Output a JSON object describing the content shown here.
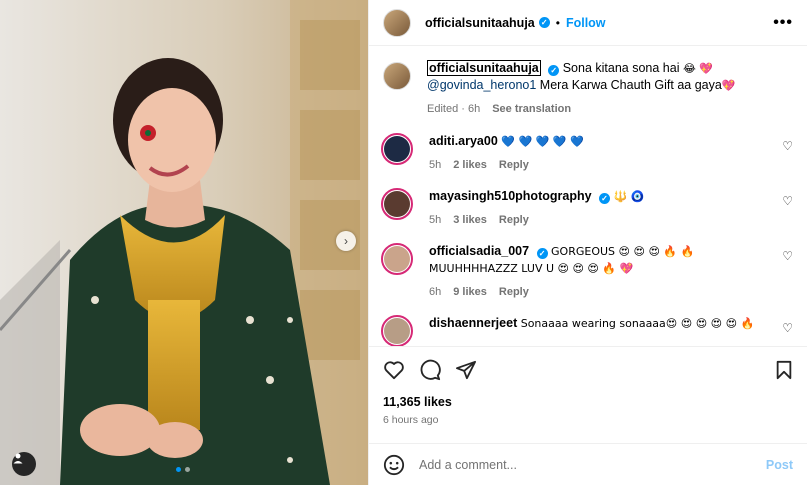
{
  "post": {
    "author": "officialsunitaahuja",
    "follow_label": "Follow",
    "separator": "•",
    "more_label": "•••",
    "caption_user": "officialsunitaahuja",
    "caption_text": "Sona kitana sona hai",
    "caption_emoji": "😂 💖",
    "caption_mention": "@govinda_herono1",
    "caption_text2": "Mera Karwa Chauth Gift aa gaya",
    "caption_emoji2": "💖",
    "caption_time": "Edited · 6h",
    "see_translation": "See translation",
    "likes": "11,365 likes",
    "time_ago": "6 hours ago"
  },
  "comments": [
    {
      "user": "aditi.arya00",
      "verified": false,
      "text": "💙 💙 💙 💙 💙",
      "text2": "",
      "time": "5h",
      "likes": "2 likes",
      "reply": "Reply"
    },
    {
      "user": "mayasingh510photography",
      "verified": true,
      "text": "🔱 🧿",
      "text2": "",
      "time": "5h",
      "likes": "3 likes",
      "reply": "Reply"
    },
    {
      "user": "officialsadia_007",
      "verified": true,
      "text": "GORGEOUS 😍 😍 😍 🔥 🔥",
      "text2": "MUUHHHHAZZZ LUV U 😍 😍 😍 🔥 💖",
      "time": "6h",
      "likes": "9 likes",
      "reply": "Reply"
    },
    {
      "user": "dishaennerjeet",
      "verified": false,
      "text": "Sonaaaa wearing sonaaaa😍 😍 😍 😍 😍 🔥",
      "text2": "",
      "time": "",
      "likes": "",
      "reply": ""
    }
  ],
  "composer": {
    "placeholder": "Add a comment...",
    "post_label": "Post"
  },
  "icons": {
    "like": "heart-icon",
    "comment": "comment-icon",
    "share": "share-icon",
    "save": "bookmark-icon",
    "emoji": "emoji-icon",
    "next": "chevron-right-icon",
    "tags": "user-tag-icon"
  },
  "colors": {
    "accent": "#0095f6",
    "secondary_text": "#737373",
    "story_ring": "#d62976"
  }
}
